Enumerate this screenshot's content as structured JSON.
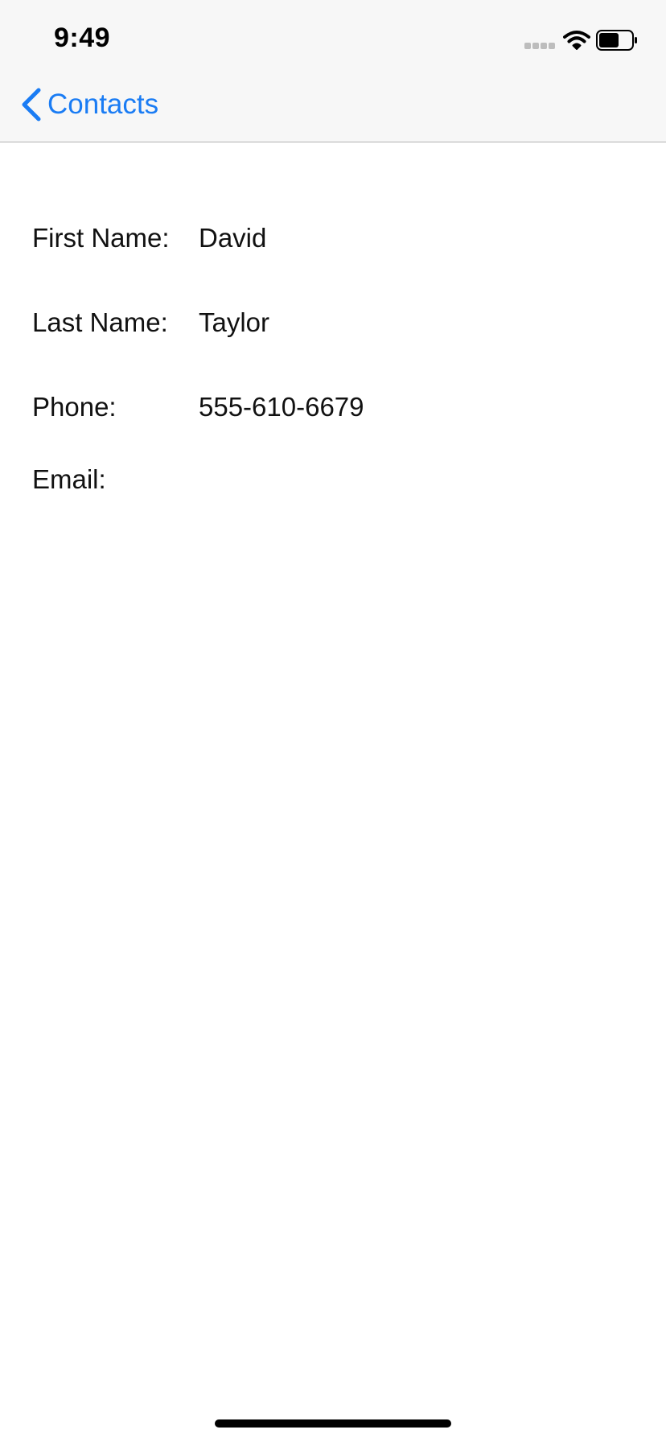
{
  "status_bar": {
    "time": "9:49"
  },
  "navigation": {
    "back_label": "Contacts"
  },
  "contact": {
    "first_name_label": "First Name:",
    "first_name": "David",
    "last_name_label": "Last Name:",
    "last_name": "Taylor",
    "phone_label": "Phone:",
    "phone": "555-610-6679",
    "email_label": "Email:",
    "email": ""
  },
  "colors": {
    "accent": "#1a7cf4",
    "nav_bar_background": "#f7f7f7"
  }
}
